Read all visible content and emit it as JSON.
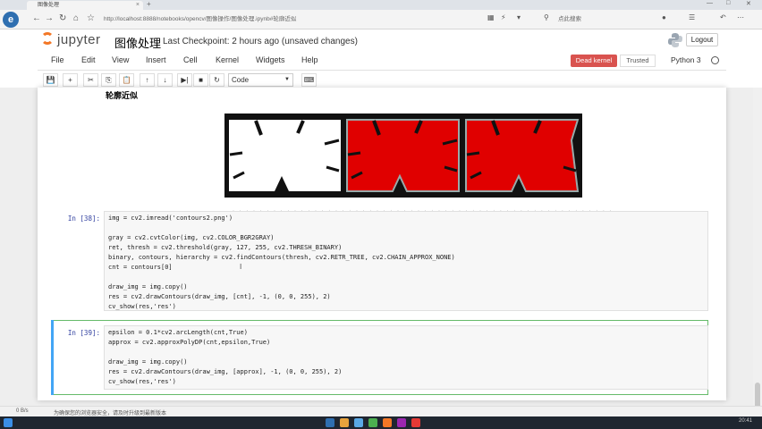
{
  "browser": {
    "tab_title": "图像处理",
    "tab_close": "×",
    "new_tab": "+",
    "url": "http://localhost:8888/notebooks/opencv/图像操作/图像处理.ipynb#轮廓近似",
    "search_hint": "点此搜索",
    "window_controls": [
      "—",
      "□",
      "✕"
    ]
  },
  "header": {
    "logo_text": "jupyter",
    "notebook_title": "图像处理",
    "checkpoint": "Last Checkpoint: 2 hours ago (unsaved changes)",
    "logout": "Logout"
  },
  "menu": {
    "items": [
      "File",
      "Edit",
      "View",
      "Insert",
      "Cell",
      "Kernel",
      "Widgets",
      "Help"
    ],
    "kernel_state": "Dead kernel",
    "trusted": "Trusted",
    "kernel_name": "Python 3"
  },
  "toolbar": {
    "buttons": [
      "💾",
      "+",
      "✂",
      "⎘",
      "📋",
      "↑",
      "↓",
      "▶|",
      "■",
      "↻"
    ],
    "cell_type": "Code",
    "keyboard_icon": "⌨"
  },
  "notebook": {
    "markdown_heading": "轮廓近似",
    "cells": [
      {
        "prompt": "In [38]:",
        "lines": [
          "img = cv2.imread('contours2.png')",
          "",
          "gray = cv2.cvtColor(img, cv2.COLOR_BGR2GRAY)",
          "ret, thresh = cv2.threshold(gray, 127, 255, cv2.THRESH_BINARY)",
          "binary, contours, hierarchy = cv2.findContours(thresh, cv2.RETR_TREE, cv2.CHAIN_APPROX_NONE)",
          "cnt = contours[0]",
          "",
          "draw_img = img.copy()",
          "res = cv2.drawContours(draw_img, [cnt], -1, (0, 0, 255), 2)",
          "cv_show(res,'res')"
        ]
      },
      {
        "prompt": "In [39]:",
        "lines": [
          "epsilon = 0.1*cv2.arcLength(cnt,True)",
          "approx = cv2.approxPolyDP(cnt,epsilon,True)",
          "",
          "draw_img = img.copy()",
          "res = cv2.drawContours(draw_img, [approx], -1, (0, 0, 255), 2)",
          "cv_show(res,'res')"
        ]
      }
    ]
  },
  "colors": {
    "jupyter_orange": "#f37726",
    "dead_kernel": "#d9534f",
    "contour_red": "#e00000",
    "prompt_blue": "#303f9f"
  },
  "statusbar": {
    "left": "0 B/s",
    "hint": "为确保您的浏览器安全，请及时升级到最新版本"
  },
  "taskbar": {
    "time": "20:41"
  }
}
